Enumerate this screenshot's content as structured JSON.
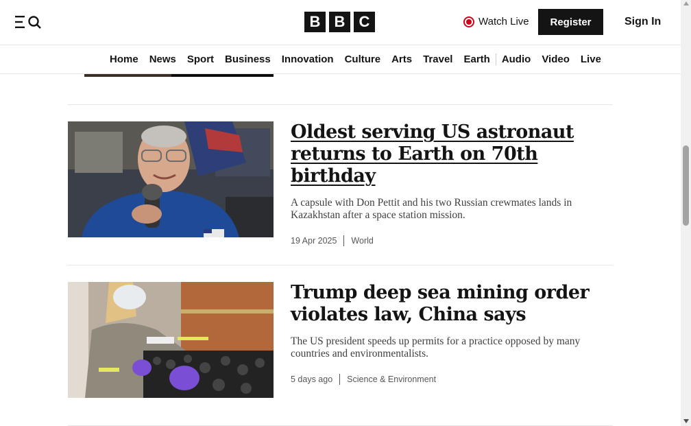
{
  "header": {
    "logo_letters": [
      "B",
      "B",
      "C"
    ],
    "watch_live": "Watch Live",
    "register": "Register",
    "sign_in": "Sign In"
  },
  "nav": {
    "items": [
      "Home",
      "News",
      "Sport",
      "Business",
      "Innovation",
      "Culture",
      "Arts",
      "Travel",
      "Earth",
      "Audio",
      "Video",
      "Live"
    ]
  },
  "articles": [
    {
      "headline": "Oldest serving US astronaut returns to Earth on 70th birthday",
      "summary": "A capsule with Don Pettit and his two Russian crewmates lands in Kazakhstan after a space station mission.",
      "date": "19 Apr 2025",
      "section": "World",
      "image": "astronaut-photo"
    },
    {
      "headline": "Trump deep sea mining order violates law, China says",
      "summary": "The US president speeds up permits for a practice opposed by many countries and environmentalists.",
      "date": "5 days ago",
      "section": "Science & Environment",
      "image": "deep-sea-mining-photo"
    }
  ],
  "colors": {
    "live_red": "#d0021b",
    "black": "#141414"
  }
}
